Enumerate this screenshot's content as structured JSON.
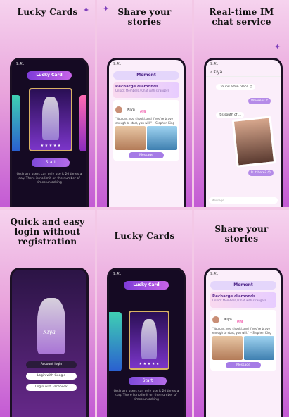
{
  "captions": {
    "p1": "Lucky Cards",
    "p2": "Share your\nstories",
    "p3": "Real-time IM\nchat service",
    "p4": "Quick and easy\nlogin without\nregistration",
    "p5": "Lucky Cards",
    "p6": "Share your\nstories"
  },
  "lucky": {
    "title": "Lucky Card",
    "card_name": "Sexy",
    "stars": "★ ★ ★ ★ ★",
    "start": "Start",
    "note": "Ordinary users can only use it 20 times a day. There is no limit on the number of times unlocking"
  },
  "moment": {
    "title": "Moment",
    "banner_title": "Recharge diamonds",
    "banner_sub": "Unlock Members / Chat with strangers",
    "user": "Kiya",
    "age": "22",
    "quote": "\"You can, you should, and if you're brave enough to start, you will.\" -- Stephen King",
    "message": "Message"
  },
  "chat": {
    "name": "Kiya",
    "msg1": "I found a fun place 😊",
    "msg2": "Where is it",
    "msg3": "It's south of ...",
    "msg4": "Is it here? 😊",
    "input": "Message..."
  },
  "login": {
    "brand": "Kiya",
    "account": "Account login",
    "google": "Login with Google",
    "facebook": "Login with Facebook"
  },
  "status": {
    "time": "9:41"
  }
}
